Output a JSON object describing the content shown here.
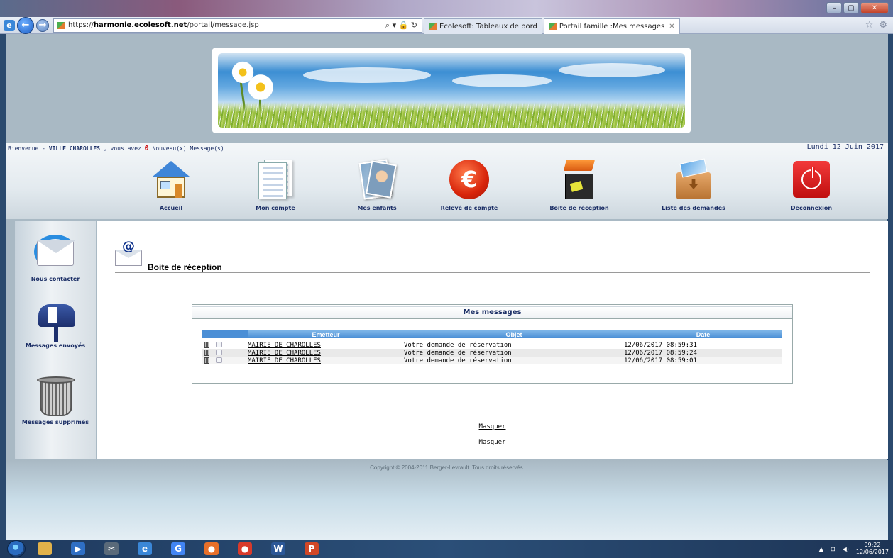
{
  "browser": {
    "url_prefix": "https://",
    "url_host": "harmonie.ecolesoft.net",
    "url_path": "/portail/message.jsp",
    "address_tools": "⌕ ▾ 🔒 ↻",
    "tabs": [
      {
        "label": "Ecolesoft: Tableaux de bord",
        "active": false
      },
      {
        "label": "Portail famille :Mes messages",
        "active": true
      }
    ],
    "close_tab": "✕"
  },
  "header": {
    "welcome_prefix": "Bienvenue - ",
    "user_name": "VILLE CHAROLLES",
    "welcome_mid": " , vous avez ",
    "new_count": "0",
    "welcome_suffix": " Nouveau(x) Message(s)",
    "date": "Lundi 12 Juin 2017"
  },
  "nav": {
    "items": [
      {
        "label": "Accueil",
        "icon": "house-icon"
      },
      {
        "label": "Mon compte",
        "icon": "document-icon"
      },
      {
        "label": "Mes enfants",
        "icon": "photos-icon"
      },
      {
        "label": "Relevé de compte",
        "icon": "euro-icon"
      },
      {
        "label": "Boite de réception",
        "icon": "inbox-icon"
      },
      {
        "label": "Liste des demandes",
        "icon": "tray-icon"
      },
      {
        "label": "Deconnexion",
        "icon": "power-icon"
      }
    ]
  },
  "sidebar": {
    "items": [
      {
        "label": "Nous contacter",
        "icon": "contact-envelope-icon"
      },
      {
        "label": "Messages envoyés",
        "icon": "mailbox-icon"
      },
      {
        "label": "Messages supprimés",
        "icon": "trash-icon"
      }
    ]
  },
  "main": {
    "title": "Boite de réception",
    "panel_title": "Mes messages",
    "columns": [
      "Emetteur",
      "Objet",
      "Date"
    ],
    "messages": [
      {
        "sender": "MAIRIE DE CHAROLLES",
        "subject": "Votre demande de réservation",
        "date": "12/06/2017 08:59:31"
      },
      {
        "sender": "MAIRIE DE CHAROLLES",
        "subject": "Votre demande de réservation",
        "date": "12/06/2017 08:59:24"
      },
      {
        "sender": "MAIRIE DE CHAROLLES",
        "subject": "Votre demande de réservation",
        "date": "12/06/2017 08:59:01"
      }
    ],
    "hide_link_1": "Masquer",
    "hide_link_2": "Masquer"
  },
  "footer": {
    "copyright": "Copyright © 2004-2011 Berger-Levrault. Tous droits réservés."
  },
  "taskbar": {
    "time": "09:22",
    "date": "12/06/2017",
    "apps": [
      {
        "icon": "explorer-icon",
        "glyph": "",
        "color": "#e2b24a"
      },
      {
        "icon": "media-player-icon",
        "glyph": "▶",
        "color": "#2f6fc4"
      },
      {
        "icon": "snipping-tool-icon",
        "glyph": "✂",
        "color": "#5a6a7a"
      },
      {
        "icon": "internet-explorer-icon",
        "glyph": "e",
        "color": "#3a87d8"
      },
      {
        "icon": "google-icon",
        "glyph": "G",
        "color": "#4285f4"
      },
      {
        "icon": "firefox-icon",
        "glyph": "●",
        "color": "#e8702a"
      },
      {
        "icon": "chrome-icon",
        "glyph": "●",
        "color": "#d93a2b"
      },
      {
        "icon": "word-icon",
        "glyph": "W",
        "color": "#2b5797"
      },
      {
        "icon": "powerpoint-icon",
        "glyph": "P",
        "color": "#d24726"
      }
    ]
  },
  "colors": {
    "accent_blue": "#1c2f66",
    "table_header": "#4b8fd6",
    "page_bg": "#a9b9c4"
  }
}
